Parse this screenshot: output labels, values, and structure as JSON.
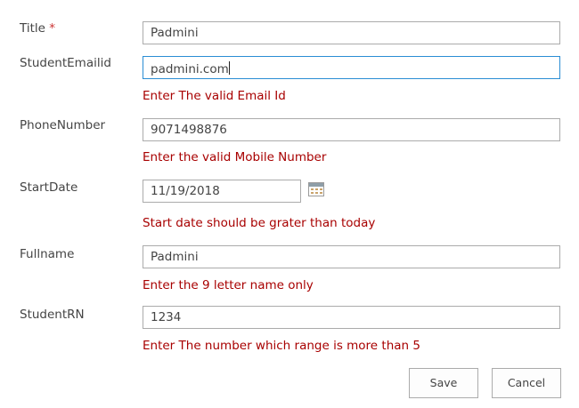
{
  "fields": {
    "title": {
      "label": "Title",
      "required_mark": "*",
      "value": "Padmini"
    },
    "email": {
      "label": "StudentEmailid",
      "value": "padmini.com",
      "error": "Enter The valid Email Id"
    },
    "phone": {
      "label": "PhoneNumber",
      "value": "9071498876",
      "error": "Enter the valid Mobile Number"
    },
    "startdate": {
      "label": "StartDate",
      "value": "11/19/2018",
      "error": "Start date should be grater than today",
      "icon": "calendar-icon"
    },
    "fullname": {
      "label": "Fullname",
      "value": "Padmini",
      "error": "Enter the 9 letter name only"
    },
    "rn": {
      "label": "StudentRN",
      "value": "1234",
      "error": "Enter The number which range is more than 5"
    }
  },
  "buttons": {
    "save": "Save",
    "cancel": "Cancel"
  },
  "colors": {
    "error": "#a80000",
    "focus_border": "#2a8dd4",
    "required": "#cc3333"
  }
}
